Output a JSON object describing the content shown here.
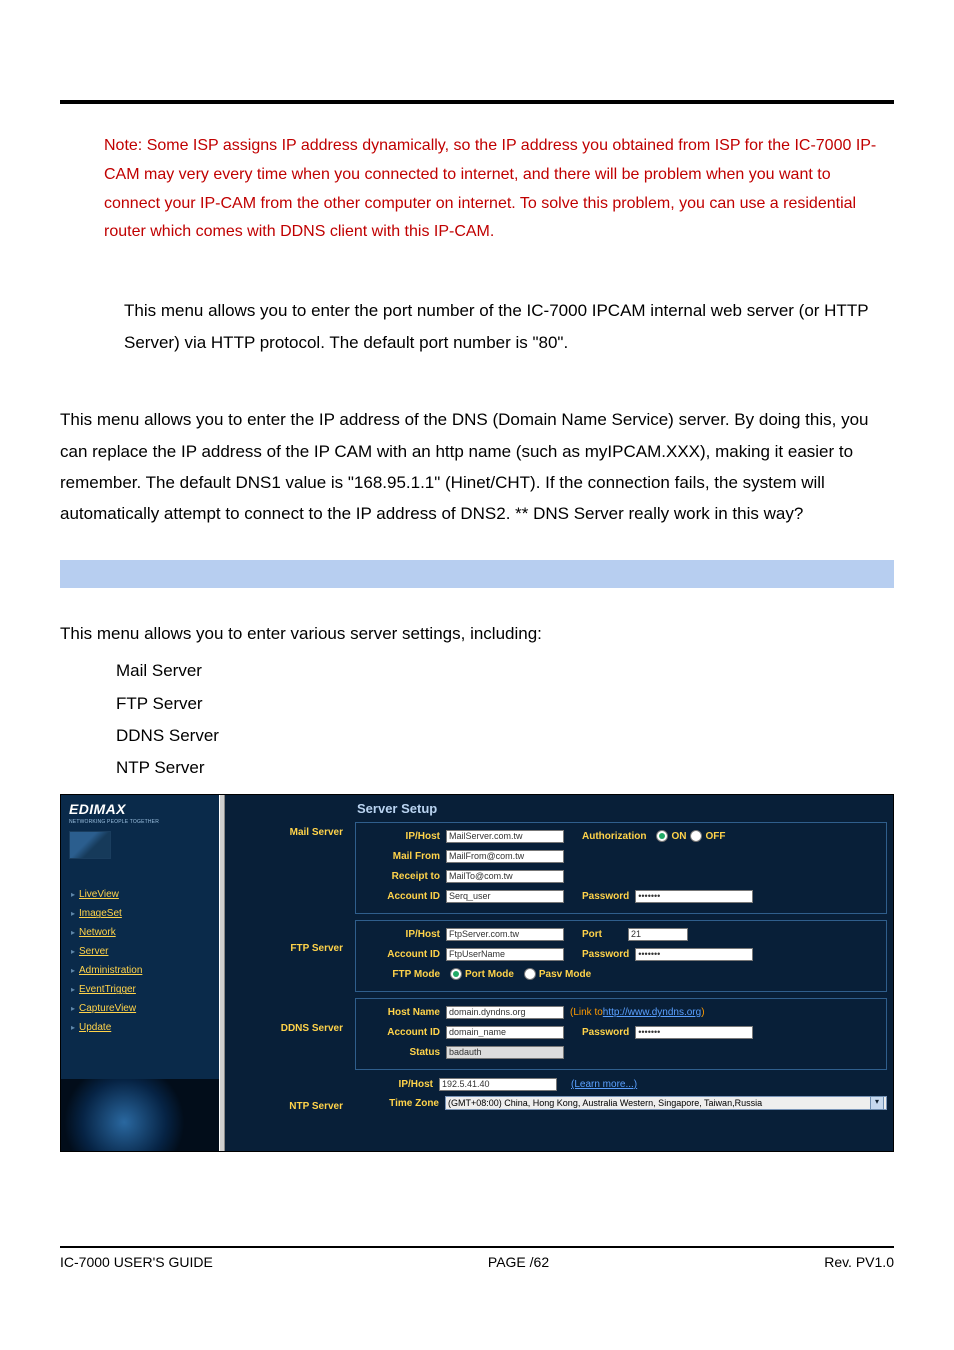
{
  "note": {
    "prefix": "Note: ",
    "text": "Some ISP assigns IP address dynamically, so the IP address you obtained from ISP for the IC-7000 IP-CAM may very every time when you connected to internet, and there will be problem when you want to connect your IP-CAM from the other computer on internet. To solve this problem, you can use a residential router which comes with DDNS client with this IP-CAM."
  },
  "para_http": "This menu allows you to enter the port number of the IC-7000 IPCAM internal web server (or HTTP Server) via HTTP protocol. The default port number is \"80\".",
  "para_dns": "This menu allows you to enter the IP address of the DNS (Domain Name Service) server. By doing this, you can replace the IP address of the IP CAM with an http name (such as myIPCAM.XXX), making it easier to remember. The default DNS1 value is \"168.95.1.1\" (Hinet/CHT). If the connection fails, the system will automatically attempt to connect to the IP address of DNS2. ** DNS Server really work in this way?",
  "servers_intro": "This menu allows you to enter various server settings, including:",
  "bullets": {
    "mail": "Mail Server",
    "ftp": "FTP Server",
    "ddns": "DDNS Server",
    "ntp": "NTP Server"
  },
  "ui": {
    "brand": "EDIMAX",
    "brand_sub": "NETWORKING PEOPLE TOGETHER",
    "nav": {
      "liveview": "LiveView",
      "imageset": "ImageSet",
      "network": "Network",
      "server": "Server",
      "administration": "Administration",
      "eventtrigger": "EventTrigger",
      "captureview": "CaptureView",
      "update": "Update"
    },
    "mid_labels": {
      "mail": "Mail Server",
      "ftp": "FTP Server",
      "ddns": "DDNS Server",
      "ntp": "NTP Server"
    },
    "section_title": "Server Setup",
    "labels": {
      "ip_host": "IP/Host",
      "authorization": "Authorization",
      "on": "ON",
      "off": "OFF",
      "mail_from": "Mail From",
      "receipt_to": "Receipt to",
      "account_id": "Account ID",
      "password": "Password",
      "port": "Port",
      "ftp_mode": "FTP Mode",
      "port_mode": "Port Mode",
      "pasv_mode": "Pasv Mode",
      "host_name": "Host Name",
      "status": "Status",
      "time_zone": "Time Zone",
      "link_to_prefix": "(Link to ",
      "link_to_url": "http://www.dyndns.org",
      "link_to_suffix": ")",
      "learn_more": "(Learn more...)"
    },
    "values": {
      "mail_host": "MailServer.com.tw",
      "mail_from": "MailFrom@com.tw",
      "mail_to": "MailTo@com.tw",
      "mail_account": "Serq_user",
      "mail_password": "•••••••",
      "ftp_host": "FtpServer.com.tw",
      "ftp_port": "21",
      "ftp_account": "FtpUserName",
      "ftp_password": "•••••••",
      "ddns_host": "domain.dyndns.org",
      "ddns_account": "domain_name",
      "ddns_password": "•••••••",
      "ddns_status": "badauth",
      "ntp_host": "192.5.41.40",
      "timezone": "(GMT+08:00) China, Hong Kong, Australia Western, Singapore, Taiwan,Russia"
    }
  },
  "footer": {
    "left": "IC-7000 USER'S GUIDE",
    "middle_prefix": "PAGE   ",
    "middle_suffix": "/62",
    "right": "Rev. PV1.0"
  }
}
